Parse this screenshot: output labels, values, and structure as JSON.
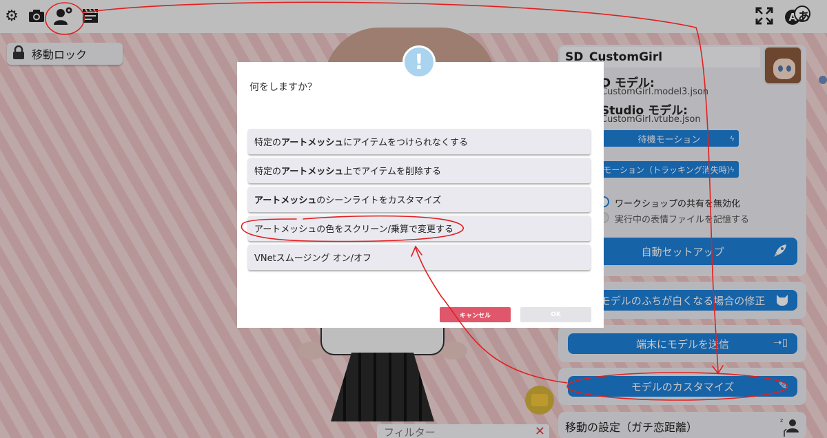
{
  "toolbar": {
    "icons": [
      "gear-icon",
      "camera-icon",
      "user-settings-icon",
      "clapperboard-icon",
      "fullscreen-icon",
      "language-icon"
    ],
    "language_glyph": "あ"
  },
  "lock": {
    "label": "移動ロック"
  },
  "model_panel": {
    "name": "SD_CustomGirl",
    "live2d_label": "D モデル:",
    "live2d_file": "CustomGirl.model3.json",
    "vts_label": "Studio モデル:",
    "vts_file": "CustomGirl.vtube.json",
    "idle_motion": "待機モーション",
    "tracking_lost_motion": "モーション（トラッキング消失時）",
    "workshop_toggle": "ワークショップの共有を無効化",
    "remember_expr": "実行中の表情ファイルを記憶する",
    "auto_setup": "自動セットアップ",
    "fix_edges": "モデルのふちが白くなる場合の修正",
    "send_model": "端末にモデルを送信",
    "customize": "モデルのカスタマイズ",
    "movement_settings": "移動の設定（ガチ恋距離）"
  },
  "filter": {
    "placeholder": "フィルター"
  },
  "dialog": {
    "question": "何をしますか？",
    "options": [
      {
        "pre": "特定の",
        "bold": "アートメッシュ",
        "post": "にアイテムをつけられなくする"
      },
      {
        "pre": "特定の",
        "bold": "アートメッシュ",
        "post": "上でアイテムを削除する"
      },
      {
        "pre": "",
        "bold": "アートメッシュ",
        "post": "のシーンライトをカスタマイズ"
      },
      {
        "pre": "アートメッシュの色をスクリーン/乗算で変更する",
        "bold": "",
        "post": ""
      },
      {
        "pre": "VNetスムージング オン/オフ",
        "bold": "",
        "post": ""
      }
    ],
    "cancel": "キャンセル",
    "ok": "OK"
  },
  "colors": {
    "accent": "#1d7fd8",
    "cancel": "#e0566a",
    "annotation": "#e02020"
  }
}
